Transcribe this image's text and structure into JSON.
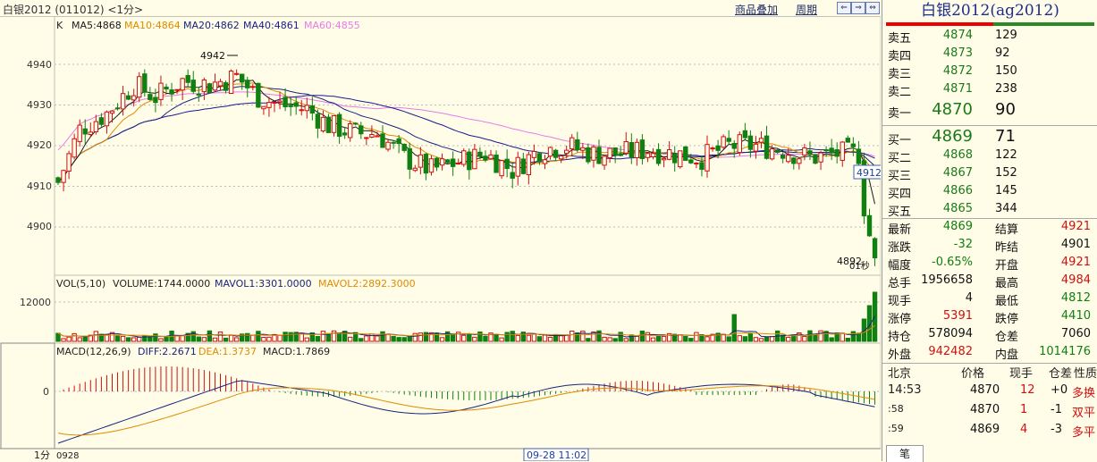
{
  "header": {
    "title": "白银2012 (011012) <1分>",
    "link_overlay": "商品叠加",
    "link_period": "周期",
    "nav_buttons": [
      "⇐",
      "⇒",
      "⇔"
    ]
  },
  "main_panel": {
    "k_label": "K",
    "ma": [
      {
        "label": "MA5:4868",
        "color": "#1a1a1a"
      },
      {
        "label": "MA10:4864",
        "color": "#e08a00"
      },
      {
        "label": "MA20:4862",
        "color": "#1a237e"
      },
      {
        "label": "MA40:4861",
        "color": "#1a1a8e"
      },
      {
        "label": "MA60:4855",
        "color": "#e87ae8"
      }
    ],
    "y_ticks": [
      "4940",
      "4930",
      "4920",
      "4910",
      "4900"
    ],
    "high_label": "4942",
    "low_label": "4892",
    "cursor_price": "4912",
    "seconds_label": "01秒"
  },
  "volume_panel": {
    "title": "VOL(5,10)",
    "volume": "VOLUME:1744.0000",
    "mavol1": "MAVOL1:3301.0000",
    "mavol2": "MAVOL2:2892.3000",
    "y_tick": "12000"
  },
  "macd_panel": {
    "title": "MACD(12,26,9)",
    "diff": "DIFF:2.2671",
    "dea": "DEA:1.3737",
    "macd": "MACD:1.7869",
    "y_tick": "0"
  },
  "bottom": {
    "period_label": "1分",
    "date_label": "0928",
    "cursor_time": "09-28 11:02"
  },
  "quote": {
    "name": "白银2012(ag2012)",
    "asks": [
      {
        "label": "卖五",
        "price": "4874",
        "vol": "129"
      },
      {
        "label": "卖四",
        "price": "4873",
        "vol": "92"
      },
      {
        "label": "卖三",
        "price": "4872",
        "vol": "150"
      },
      {
        "label": "卖二",
        "price": "4871",
        "vol": "238"
      }
    ],
    "ask1": {
      "label": "卖一",
      "price": "4870",
      "vol": "90"
    },
    "bid1": {
      "label": "买一",
      "price": "4869",
      "vol": "71"
    },
    "bids": [
      {
        "label": "买二",
        "price": "4868",
        "vol": "122"
      },
      {
        "label": "买三",
        "price": "4867",
        "vol": "152"
      },
      {
        "label": "买四",
        "price": "4866",
        "vol": "145"
      },
      {
        "label": "买五",
        "price": "4865",
        "vol": "344"
      }
    ],
    "stats": [
      {
        "l1": "最新",
        "v1": "4869",
        "c1": "green",
        "l2": "结算",
        "v2": "4921",
        "c2": "red"
      },
      {
        "l1": "涨跌",
        "v1": "-32",
        "c1": "green",
        "l2": "昨结",
        "v2": "4901",
        "c2": "blk"
      },
      {
        "l1": "幅度",
        "v1": "-0.65%",
        "c1": "green",
        "l2": "开盘",
        "v2": "4921",
        "c2": "red"
      },
      {
        "l1": "总手",
        "v1": "1956658",
        "c1": "blk",
        "l2": "最高",
        "v2": "4984",
        "c2": "red"
      },
      {
        "l1": "现手",
        "v1": "4",
        "c1": "blk",
        "l2": "最低",
        "v2": "4812",
        "c2": "green"
      },
      {
        "l1": "涨停",
        "v1": "5391",
        "c1": "red",
        "l2": "跌停",
        "v2": "4410",
        "c2": "green"
      },
      {
        "l1": "持仓",
        "v1": "578094",
        "c1": "blk",
        "l2": "仓差",
        "v2": "7060",
        "c2": "blk"
      },
      {
        "l1": "外盘",
        "v1": "942482",
        "c1": "red",
        "l2": "内盘",
        "v2": "1014176",
        "c2": "green"
      }
    ],
    "tick_headers": [
      "北京",
      "价格",
      "现手",
      "仓差",
      "性质"
    ],
    "ticks": [
      {
        "time": "14:53",
        "price": "4870",
        "vol": "12",
        "diff": "+0",
        "nature": "多换"
      },
      {
        "time": ":58",
        "price": "4870",
        "vol": "1",
        "diff": "-1",
        "nature": "双平"
      },
      {
        "time": ":59",
        "price": "4869",
        "vol": "4",
        "diff": "-3",
        "nature": "多平"
      }
    ],
    "tab_label": "笔"
  },
  "colors": {
    "up": "#d01010",
    "down": "#108010",
    "ma5": "#1a1a1a",
    "ma10": "#e08a00",
    "ma20": "#1a237e",
    "ma60": "#e87ae8"
  }
}
